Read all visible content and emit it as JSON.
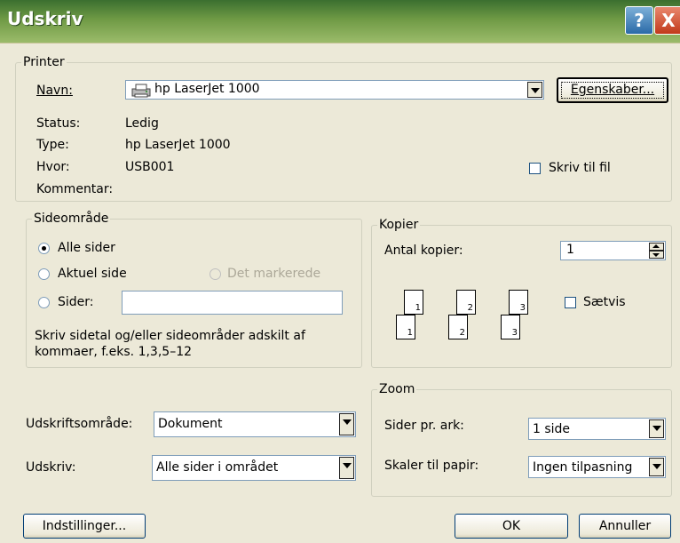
{
  "window": {
    "title": "Udskriv",
    "help_label": "?",
    "close_label": "X"
  },
  "printer": {
    "legend": "Printer",
    "name_label": "Navn:",
    "selected_printer": "hp LaserJet 1000",
    "properties_button": "Egenskaber...",
    "status_label": "Status:",
    "status_value": "Ledig",
    "type_label": "Type:",
    "type_value": "hp LaserJet 1000",
    "where_label": "Hvor:",
    "where_value": "USB001",
    "comment_label": "Kommentar:",
    "print_to_file": "Skriv til fil"
  },
  "range": {
    "legend": "Sideområde",
    "all_pages": "Alle sider",
    "current_page": "Aktuel side",
    "selection": "Det markerede",
    "pages_label": "Sider:",
    "pages_value": "",
    "help_line1": "Skriv sidetal og/eller sideområder adskilt af",
    "help_line2": "kommaer, f.eks. 1,3,5–12"
  },
  "copies": {
    "legend": "Kopier",
    "count_label": "Antal kopier:",
    "count_value": "1",
    "collate": "Sætvis",
    "collate_pages": [
      "1",
      "2",
      "3"
    ]
  },
  "zoom": {
    "legend": "Zoom",
    "pages_per_sheet_label": "Sider pr. ark:",
    "pages_per_sheet_value": "1 side",
    "scale_label": "Skaler til papir:",
    "scale_value": "Ingen tilpasning"
  },
  "print_options": {
    "print_what_label": "Udskriftsområde:",
    "print_what_value": "Dokument",
    "print_label": "Udskriv:",
    "print_value": "Alle sider i området"
  },
  "buttons": {
    "options": "Indstillinger...",
    "ok": "OK",
    "cancel": "Annuller"
  }
}
